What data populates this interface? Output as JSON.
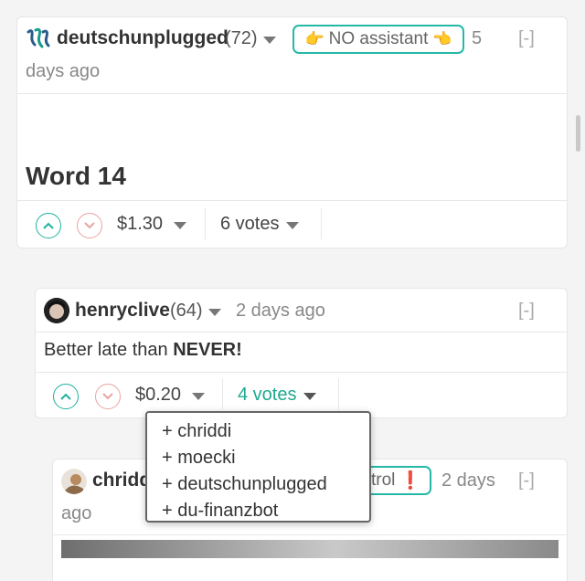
{
  "comments": [
    {
      "author": "deutschunplugged",
      "reputation": "(72)",
      "badge": "NO assistant",
      "badge_emoji_left": "👉",
      "badge_emoji_right": "👈",
      "time_part1": "5",
      "time_part2": "days ago",
      "collapse": "[-]",
      "title": "Word 14",
      "payout": "$1.30",
      "votes": "6 votes"
    },
    {
      "author": "henryclive",
      "reputation": "(64)",
      "time": "2 days ago",
      "collapse": "[-]",
      "body_prefix": "Better late than ",
      "body_bold": "NEVER!",
      "payout": "$0.20",
      "votes": "4 votes",
      "voters": [
        "+ chriddi",
        "+ moecki",
        "+ deutschunplugged",
        "+ du-finanzbot"
      ]
    },
    {
      "author": "chridd",
      "badge": "trol",
      "badge_emoji": "❗",
      "time_part1": "2 days",
      "time_part2": "ago",
      "collapse": "[-]"
    }
  ],
  "icons": {
    "logo": "steem-logo-icon",
    "upvote": "upvote-icon",
    "downvote": "downvote-icon",
    "caret": "caret-down-icon"
  },
  "colors": {
    "accent": "#1fb29e",
    "downvote": "#e9a3a3",
    "text": "#333333",
    "muted": "#888888"
  }
}
